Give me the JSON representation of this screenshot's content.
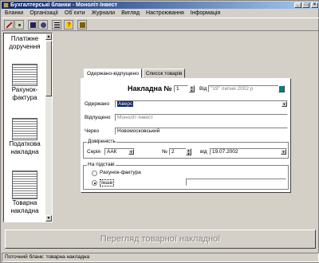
{
  "window": {
    "title": "Бухгалтерські бланки - Моноліт-Інвест"
  },
  "menu": [
    "Бланки",
    "Організації",
    "Об`єкти",
    "Журнали",
    "Вигляд",
    "Настроювання",
    "Інформація"
  ],
  "toolbar": {
    "icons": [
      "pencil-icon",
      "percent-icon",
      "floppy-icon",
      "disk-icon",
      "form-icon",
      "help-icon",
      "exit-icon"
    ]
  },
  "left_panel": {
    "thumbnails": [
      {
        "label": "Платіжне доручення"
      },
      {
        "label": "Рахунок-фактура"
      },
      {
        "label": "Податкова накладна"
      },
      {
        "label": "Товарна накладна"
      }
    ]
  },
  "form": {
    "tabs": [
      "Одержано-відпущено",
      "Список товарів"
    ],
    "nakladna_label": "Накладна №",
    "nakladna_number": "1",
    "vid_label": "Від",
    "date_text": "\"19\" липня 2002 р",
    "odergano_label": "Одержано",
    "odergano_value": "Аверс",
    "vidpushcheno_label": "Відпущено",
    "vidpushcheno_value": "Моноліт-Інвест",
    "cherez_label": "Через",
    "cherez_value": "Новомосковський",
    "dov_group": "Довіреність",
    "seria_label": "Серія",
    "seria_value": "ААК",
    "num_label": "№",
    "num_value": "2",
    "dov_vid_label": "від",
    "dov_date": "19.07.2002",
    "pidstavi_group": "На підставі",
    "radio1": "Рахунок-фактура",
    "radio2": "Інше"
  },
  "bottom_button": "Перегляд товарної накладної",
  "status": "Поточний бланк: товарна накладна"
}
